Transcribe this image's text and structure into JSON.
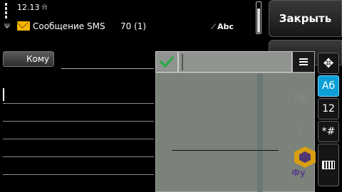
{
  "status_bar": {
    "time": "12.13",
    "alarm_icon": "alarm-icon",
    "signal_icon": "signal-icon",
    "battery_icon": "battery-icon"
  },
  "header": {
    "icon": "envelope-icon",
    "title": "Сообщение SMS",
    "char_counter": "70 (1)",
    "input_mode": "Abc"
  },
  "softkeys": {
    "close_label": "Закрыть",
    "menu_icon": "menu-icon"
  },
  "recipient": {
    "to_label": "Кому",
    "value": ""
  },
  "overlay": {
    "confirm_icon": "checkmark-icon",
    "options_icon": "options-icon",
    "input_value": ""
  },
  "toolbar": {
    "move_icon": "move-icon",
    "alpha_label": "Аб",
    "numeric_label": "12",
    "symbols_label": "*#",
    "keyboard_icon": "keyboard-icon"
  },
  "watermark": {
    "text": "Фу"
  },
  "colors": {
    "accent": "#0b9fd6",
    "confirm": "#2ea84a",
    "envelope": "#f7b500"
  }
}
